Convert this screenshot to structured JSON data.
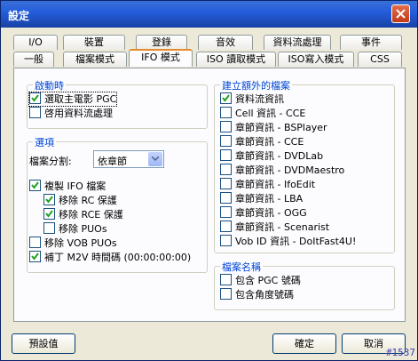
{
  "window": {
    "title": "設定"
  },
  "tabs": {
    "row1": [
      "I/O",
      "裝置",
      "登錄",
      "音效",
      "資料流處理",
      "事件"
    ],
    "row2": [
      "一般",
      "檔案模式",
      "IFO 模式",
      "ISO 讀取模式",
      "ISO寫入模式",
      "CSS"
    ],
    "active": "IFO 模式"
  },
  "startup": {
    "legend": "啟動時",
    "items": [
      {
        "label": "選取主電影 PGC",
        "checked": true
      },
      {
        "label": "啓用資料流處理",
        "checked": false
      }
    ]
  },
  "options": {
    "legend": "選項",
    "file_split_label": "檔案分割:",
    "file_split_value": "依章節",
    "items": [
      {
        "label": "複製 IFO 檔案",
        "checked": true
      },
      {
        "label": "移除 RC 保護",
        "checked": true
      },
      {
        "label": "移除 RCE 保護",
        "checked": true
      },
      {
        "label": "移除 PUOs",
        "checked": false
      },
      {
        "label": "移除 VOB PUOs",
        "checked": false
      },
      {
        "label": "補丁 M2V 時間碼 (00:00:00:00)",
        "checked": true
      }
    ]
  },
  "extra_files": {
    "legend": "建立額外的檔案",
    "items": [
      {
        "label": "資料流資訊",
        "checked": true
      },
      {
        "label": "Cell 資訊 - CCE",
        "checked": false
      },
      {
        "label": "章節資訊 - BSPlayer",
        "checked": false
      },
      {
        "label": "章節資訊 - CCE",
        "checked": false
      },
      {
        "label": "章節資訊 - DVDLab",
        "checked": false
      },
      {
        "label": "章節資訊 - DVDMaestro",
        "checked": false
      },
      {
        "label": "章節資訊 - IfoEdit",
        "checked": false
      },
      {
        "label": "章節資訊 - LBA",
        "checked": false
      },
      {
        "label": "章節資訊 - OGG",
        "checked": false
      },
      {
        "label": "章節資訊 - Scenarist",
        "checked": false
      },
      {
        "label": "Vob ID 資訊 - DoItFast4U!",
        "checked": false
      }
    ]
  },
  "filename": {
    "legend": "檔案名稱",
    "items": [
      {
        "label": "包含 PGC 號碼",
        "checked": false
      },
      {
        "label": "包含角度號碼",
        "checked": false
      }
    ]
  },
  "buttons": {
    "defaults": "預設值",
    "ok": "確定",
    "cancel": "取消"
  },
  "watermark": "#1537"
}
